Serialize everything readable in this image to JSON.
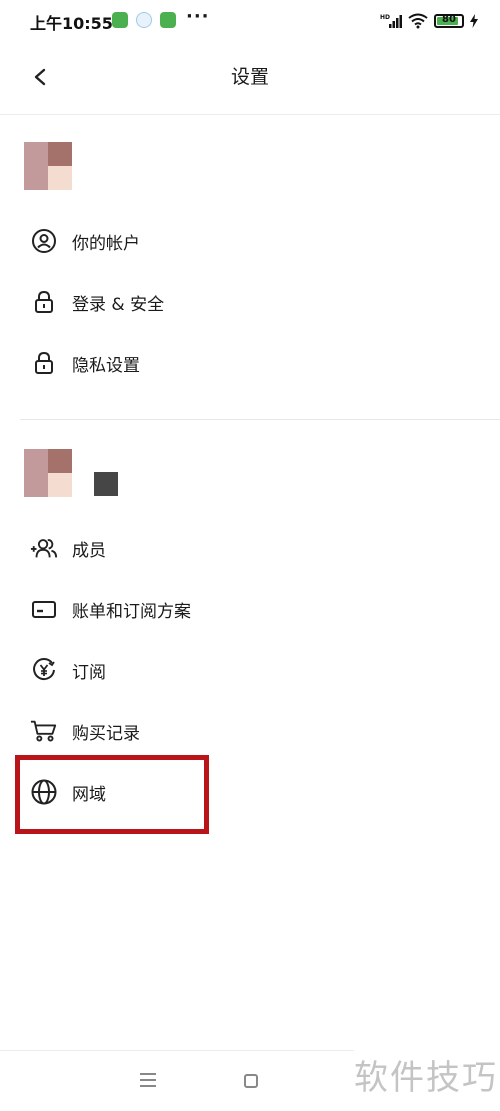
{
  "status_bar": {
    "time": "上午10:55",
    "dots": "···",
    "network": "HD",
    "battery": "80"
  },
  "header": {
    "title": "设置"
  },
  "personal_section": {
    "items": [
      {
        "label": "你的帐户",
        "icon": "account-circle-icon"
      },
      {
        "label": "登录 & 安全",
        "icon": "lock-icon"
      },
      {
        "label": "隐私设置",
        "icon": "lock-icon"
      }
    ]
  },
  "workspace_section": {
    "items": [
      {
        "label": "成员",
        "icon": "add-members-icon"
      },
      {
        "label": "账单和订阅方案",
        "icon": "credit-card-icon"
      },
      {
        "label": "订阅",
        "icon": "yen-subscription-icon"
      },
      {
        "label": "购买记录",
        "icon": "shopping-cart-icon"
      },
      {
        "label": "网域",
        "icon": "globe-icon"
      }
    ]
  },
  "colors": {
    "highlight": "#b8141a",
    "battery": "#4caf50"
  },
  "watermark": "软件技巧"
}
